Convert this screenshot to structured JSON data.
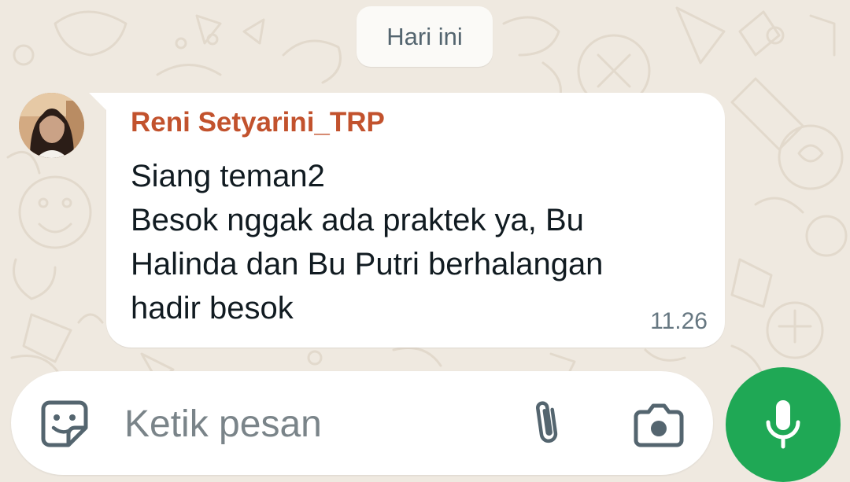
{
  "date_divider": {
    "label": "Hari ini"
  },
  "message": {
    "sender": "Reni Setyarini_TRP",
    "lines": [
      "Siang teman2",
      "Besok nggak ada praktek ya, Bu",
      "Halinda dan Bu Putri berhalangan",
      "hadir besok"
    ],
    "time": "11.26"
  },
  "composer": {
    "placeholder": "Ketik pesan",
    "icons": {
      "emoji": "sticker-smiley-icon",
      "attach": "paperclip-icon",
      "camera": "camera-icon",
      "mic": "microphone-icon"
    }
  },
  "colors": {
    "background": "#efe9e0",
    "sender_name": "#c2522d",
    "mic_button": "#1fa855",
    "icon_gray": "#54656f"
  }
}
